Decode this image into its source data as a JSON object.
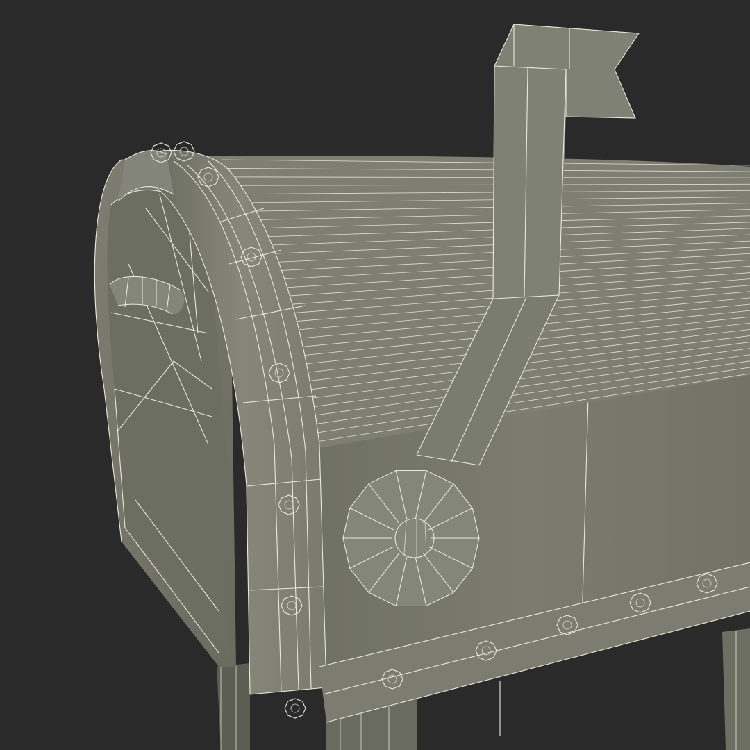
{
  "scene": {
    "subject": "mailbox-3d-wireframe",
    "background_color": "#2a2a2a",
    "surface_color": "#7a7b6e",
    "surface_dark": "#5f6056",
    "surface_light": "#8a8b7e",
    "wire_color": "#e9eadb"
  }
}
